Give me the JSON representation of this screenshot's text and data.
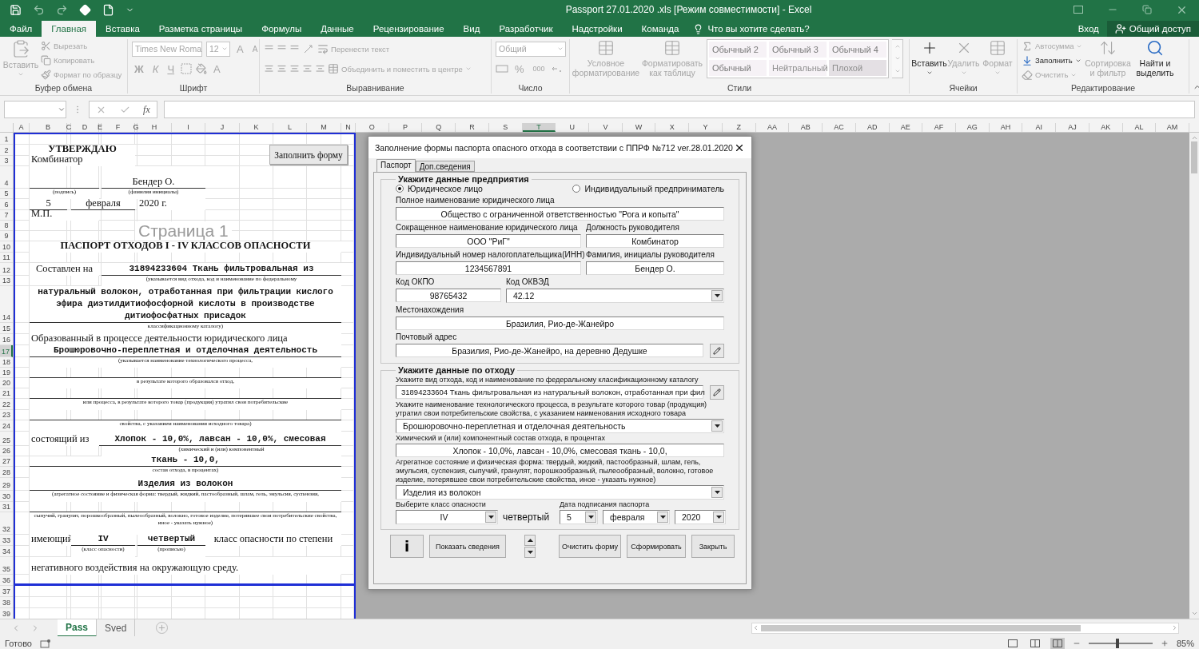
{
  "window": {
    "title": "Passport 27.01.2020 .xls  [Режим совместимости] - Excel"
  },
  "ribbon": {
    "tabs": [
      {
        "label": "Файл",
        "selected": false
      },
      {
        "label": "Главная",
        "selected": true
      },
      {
        "label": "Вставка",
        "selected": false
      },
      {
        "label": "Разметка страницы",
        "selected": false
      },
      {
        "label": "Формулы",
        "selected": false
      },
      {
        "label": "Данные",
        "selected": false
      },
      {
        "label": "Рецензирование",
        "selected": false
      },
      {
        "label": "Вид",
        "selected": false
      },
      {
        "label": "Разработчик",
        "selected": false
      },
      {
        "label": "Надстройки",
        "selected": false
      },
      {
        "label": "Команда",
        "selected": false
      }
    ],
    "tell_me": "Что вы хотите сделать?",
    "sign_in": "Вход",
    "share": "Общий доступ",
    "groups": [
      {
        "kind": "clipboard",
        "label": "Буфер обмена",
        "paste": {
          "label": "Вставить",
          "disabled": true
        },
        "actions": [
          {
            "label": "Вырезать",
            "disabled": true
          },
          {
            "label": "Копировать",
            "disabled": true
          },
          {
            "label": "Формат по образцу",
            "disabled": true
          }
        ]
      },
      {
        "kind": "font",
        "label": "Шрифт",
        "disabled": true,
        "font": "Times New Roma",
        "size": "12",
        "grow": "A",
        "shrink": "A",
        "styles": [
          "Ж",
          "К",
          "Ч"
        ],
        "color_glyph": "A"
      },
      {
        "kind": "alignment",
        "label": "Выравнивание",
        "disabled": true,
        "wrap": "Перенести текст",
        "merge": "Объединить и поместить в центре"
      },
      {
        "kind": "number",
        "label": "Число",
        "disabled": true,
        "format": "Общий",
        "percent": "%",
        "thousands": "000"
      },
      {
        "kind": "styles",
        "label": "Стили",
        "disabled": true,
        "conditional": "Условное форматирование",
        "as_table": "Форматировать как таблицу",
        "gallery": [
          "Обычный 2",
          "Обычный 3",
          "Обычный 4",
          "Обычный",
          "Нейтральный",
          "Плохой"
        ]
      },
      {
        "kind": "cells",
        "label": "Ячейки",
        "buttons": [
          {
            "label": "Вставить",
            "disabled": false
          },
          {
            "label": "Удалить",
            "disabled": true
          },
          {
            "label": "Формат",
            "disabled": true
          }
        ]
      },
      {
        "kind": "editing",
        "label": "Редактирование",
        "actions": [
          {
            "label": "Автосумма",
            "disabled": true
          },
          {
            "label": "Заполнить",
            "disabled": false
          },
          {
            "label": "Очистить",
            "disabled": true
          }
        ],
        "buttons": [
          {
            "label": "Сортировка и фильтр",
            "disabled": true
          },
          {
            "label": "Найти и выделить",
            "disabled": false
          }
        ]
      }
    ]
  },
  "formula_bar": {
    "fx": "fx"
  },
  "sheet": {
    "columns": [
      {
        "label": "A",
        "selected": false
      },
      {
        "label": "B",
        "selected": false
      },
      {
        "label": "C",
        "selected": false
      },
      {
        "label": "D",
        "selected": false
      },
      {
        "label": "E",
        "selected": false
      },
      {
        "label": "F",
        "selected": false
      },
      {
        "label": "G",
        "selected": false
      },
      {
        "label": "H",
        "selected": false
      },
      {
        "label": "I",
        "selected": false
      },
      {
        "label": "J",
        "selected": false
      },
      {
        "label": "K",
        "selected": false
      },
      {
        "label": "L",
        "selected": false
      },
      {
        "label": "M",
        "selected": false
      },
      {
        "label": "N",
        "selected": false
      },
      {
        "label": "O",
        "selected": false
      },
      {
        "label": "P",
        "selected": false
      },
      {
        "label": "Q",
        "selected": false
      },
      {
        "label": "R",
        "selected": false
      },
      {
        "label": "S",
        "selected": false
      },
      {
        "label": "T",
        "selected": true
      },
      {
        "label": "U",
        "selected": false
      },
      {
        "label": "V",
        "selected": false
      },
      {
        "label": "W",
        "selected": false
      },
      {
        "label": "X",
        "selected": false
      },
      {
        "label": "Y",
        "selected": false
      },
      {
        "label": "Z",
        "selected": false
      },
      {
        "label": "AA",
        "selected": false
      },
      {
        "label": "AB",
        "selected": false
      },
      {
        "label": "AC",
        "selected": false
      },
      {
        "label": "AD",
        "selected": false
      },
      {
        "label": "AE",
        "selected": false
      },
      {
        "label": "AF",
        "selected": false
      },
      {
        "label": "AG",
        "selected": false
      },
      {
        "label": "AH",
        "selected": false
      },
      {
        "label": "AI",
        "selected": false
      },
      {
        "label": "AJ",
        "selected": false
      },
      {
        "label": "AK",
        "selected": false
      },
      {
        "label": "AL",
        "selected": false
      },
      {
        "label": "AM",
        "selected": false
      }
    ],
    "row_headers": [
      {
        "label": "1",
        "selected": false
      },
      {
        "label": "2",
        "selected": false
      },
      {
        "label": "3",
        "selected": false
      },
      {
        "label": "4",
        "selected": false
      },
      {
        "label": "5",
        "selected": false
      },
      {
        "label": "6",
        "selected": false
      },
      {
        "label": "7",
        "selected": false
      },
      {
        "label": "8",
        "selected": false
      },
      {
        "label": "9",
        "selected": false
      },
      {
        "label": "10",
        "selected": false
      },
      {
        "label": "11",
        "selected": false
      },
      {
        "label": "12",
        "selected": false
      },
      {
        "label": "13",
        "selected": false
      },
      {
        "label": "14",
        "selected": false
      },
      {
        "label": "15",
        "selected": false
      },
      {
        "label": "16",
        "selected": false
      },
      {
        "label": "17",
        "selected": true
      },
      {
        "label": "18",
        "selected": false
      },
      {
        "label": "19",
        "selected": false
      },
      {
        "label": "20",
        "selected": false
      },
      {
        "label": "21",
        "selected": false
      },
      {
        "label": "22",
        "selected": false
      },
      {
        "label": "23",
        "selected": false
      },
      {
        "label": "24",
        "selected": false
      },
      {
        "label": "25",
        "selected": false
      },
      {
        "label": "26",
        "selected": false
      },
      {
        "label": "27",
        "selected": false
      },
      {
        "label": "28",
        "selected": false
      },
      {
        "label": "29",
        "selected": false
      },
      {
        "label": "30",
        "selected": false
      },
      {
        "label": "31",
        "selected": false
      },
      {
        "label": "32",
        "selected": false
      },
      {
        "label": "33",
        "selected": false
      },
      {
        "label": "34",
        "selected": false
      },
      {
        "label": "35",
        "selected": false
      },
      {
        "label": "36",
        "selected": false
      },
      {
        "label": "37",
        "selected": false
      },
      {
        "label": "38",
        "selected": false
      },
      {
        "label": "39",
        "selected": false
      }
    ],
    "fill_button": "Заполнить форму",
    "page_label": "Страница 1",
    "form": [
      {
        "kind": "heading",
        "text": "УТВЕРЖДАЮ"
      },
      {
        "kind": "label",
        "text": "Комбинатор"
      },
      {
        "kind": "underlined",
        "text": "Бендер О."
      },
      {
        "kind": "caption",
        "text": "(подпись)"
      },
      {
        "kind": "caption",
        "text": "(фамилия инициалы)"
      },
      {
        "kind": "underlined",
        "text": "5"
      },
      {
        "kind": "underlined",
        "text": "февраля"
      },
      {
        "kind": "label",
        "text": "2020 г."
      },
      {
        "kind": "label",
        "text": "М.П."
      },
      {
        "kind": "heading",
        "text": "ПАСПОРТ ОТХОДОВ I - IV КЛАССОВ ОПАСНОСТИ"
      },
      {
        "kind": "centered",
        "text": "Составлен на"
      },
      {
        "kind": "value",
        "text": "31894233604 Ткань фильтровальная из"
      },
      {
        "kind": "caption",
        "text": "(указывается вид отхода, код и наименование по федеральному"
      },
      {
        "kind": "value",
        "text": "натуральный волокон, отработанная при фильтрации кислого эфира диэтилдитиофосфорной кислоты в производстве дитиофосфатных присадок"
      },
      {
        "kind": "caption",
        "text": "классификационному каталогу)"
      },
      {
        "kind": "label",
        "text": "Образованный в процессе деятельности юридического лица"
      },
      {
        "kind": "value",
        "text": "Брошюровочно-переплетная и отделочная деятельность"
      },
      {
        "kind": "caption",
        "text": "(указывается наименование технологического процесса,"
      },
      {
        "kind": "caption",
        "text": "в результате которого образовался отход,"
      },
      {
        "kind": "caption",
        "text": "или процесса, в результате которого товар (продукция) утратил свои потребительские"
      },
      {
        "kind": "caption",
        "text": "свойства, с указанием наименования исходного товара)"
      },
      {
        "kind": "label",
        "text": "состоящий из"
      },
      {
        "kind": "value",
        "text": "Хлопок - 10,0%, лавсан - 10,0%, смесовая"
      },
      {
        "kind": "caption",
        "text": "(химический и (или) компонентный"
      },
      {
        "kind": "value",
        "text": "ткань - 10,0,"
      },
      {
        "kind": "caption",
        "text": "состав отхода, в процентах)"
      },
      {
        "kind": "value",
        "text": "Изделия из волокон"
      },
      {
        "kind": "caption",
        "text": "(агрегатное состояние и физическая форма: твердый, жидкий, пастообразный, шлам,  гель, эмульсия, суспензия,"
      },
      {
        "kind": "caption",
        "text": "сыпучий, гранулят, порошкообразный, пылеообразный, волокно, готовое изделие, потерявшее свои потребительские свойства, иное - указать нужное)"
      },
      {
        "kind": "label",
        "text": "имеющий"
      },
      {
        "kind": "value",
        "text": "IV"
      },
      {
        "kind": "value",
        "text": "четвертый"
      },
      {
        "kind": "centered",
        "text": "класс опасности по степени"
      },
      {
        "kind": "caption",
        "text": "(класс опасности)"
      },
      {
        "kind": "caption",
        "text": "(прописью)"
      },
      {
        "kind": "label",
        "text": "негативного воздействия на окружающую среду."
      }
    ],
    "tabs": [
      {
        "label": "Pass",
        "selected": true
      },
      {
        "label": "Sved",
        "selected": false
      }
    ]
  },
  "dialog": {
    "title": "Заполнение формы паспорта опасного отхода в соответствии с ППРФ №712 ver.28.01.2020",
    "tabs": [
      {
        "label": "Паспорт",
        "selected": true
      },
      {
        "label": "Доп.сведения",
        "selected": false
      }
    ],
    "enterprise": {
      "title": "Укажите данные предприятия",
      "radios": [
        {
          "label": "Юридическое лицо",
          "selected": true
        },
        {
          "label": "Индивидуальный предприниматель",
          "selected": false
        }
      ],
      "full_name": {
        "label": "Полное наименование юридического лица",
        "value": "Общество с ограниченной ответственностью \"Рога и копыта\""
      },
      "short_name": {
        "label": "Сокращенное наименование юридического лица",
        "value": "ООО \"РиГ\""
      },
      "head_position": {
        "label": "Должность руководителя",
        "value": "Комбинатор"
      },
      "inn": {
        "label": "Индивидуальный номер налогоплательщика(ИНН)",
        "value": "1234567891"
      },
      "head_name": {
        "label": "Фамилия, инициалы руководителя",
        "value": "Бендер О."
      },
      "okpo": {
        "label": "Код ОКПО",
        "value": "98765432"
      },
      "okved": {
        "label": "Код ОКВЭД",
        "value": "42.12"
      },
      "location": {
        "label": "Местонахождения",
        "value": "Бразилия, Рио-де-Жанейро"
      },
      "postal_address": {
        "label": "Почтовый адрес",
        "value": "Бразилия, Рио-де-Жанейро, на деревню Дедушке"
      }
    },
    "waste": {
      "title": "Укажите данные по отходу",
      "type": {
        "label": "Укажите вид отхода, код и наименование по федеральному класификационному каталогу",
        "value": "31894233604 Ткань фильтровальная из натуральный волокон, отработанная при фил"
      },
      "process": {
        "label": "Укажите наименование технологического процесса, в результате которого товар (продукция) утратил свои потребительские свойства, с указанием наименования исходного товара",
        "value": "Брошюровочно-переплетная и отделочная деятельность"
      },
      "composition": {
        "label": "Химический и (или) компонентный состав отхода, в процентах",
        "value": "Хлопок - 10,0%, лавсан - 10,0%, смесовая ткань - 10,0,"
      },
      "form": {
        "label": "Агрегатное состояние и физическая форма: твердый, жидкий,  пастообразный, шлам, гель, эмульсия, суспензия, сыпучий, гранулят, порошкообразный, пылеообразный, волокно, готовое изделие, потерявшее свои потребительские свойства, иное - указать нужное)",
        "value": "Изделия из волокон"
      },
      "hazard_class": {
        "label": "Выберите класс опасности",
        "value": "IV",
        "words": "четвертый"
      },
      "sign_date": {
        "label": "Дата подписания паспорта",
        "day": "5",
        "month": "февраля",
        "year": "2020"
      }
    },
    "buttons": {
      "info": "i",
      "show": "Показать сведения",
      "clear": "Очистить форму",
      "make": "Сформировать",
      "close": "Закрыть"
    }
  },
  "status_bar": {
    "status": "Готово",
    "views": [
      {
        "selected": false
      },
      {
        "selected": false
      },
      {
        "selected": true
      }
    ],
    "zoom": {
      "level": 0.45,
      "reading": "85%"
    }
  }
}
